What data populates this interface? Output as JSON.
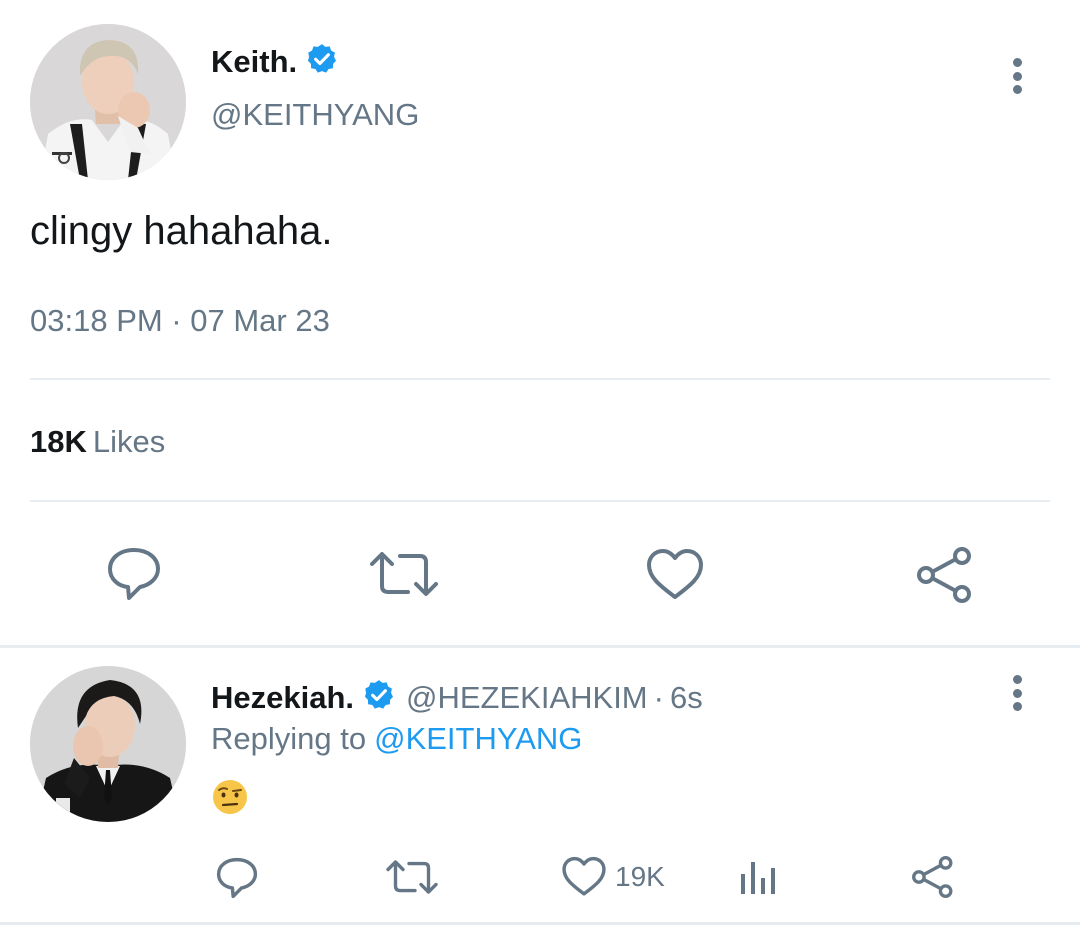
{
  "main_tweet": {
    "author_name": "Keith.",
    "author_handle": "@KEITHYANG",
    "text": "clingy hahahaha.",
    "timestamp": "03:18 PM · 07 Mar 23",
    "likes_count": "18K",
    "likes_label": "Likes",
    "icons": {
      "avatar": "avatar-photo",
      "verified": "verified-badge-icon",
      "more": "more-options-icon",
      "reply": "reply-icon",
      "retweet": "retweet-icon",
      "like": "heart-icon",
      "share": "share-icon"
    }
  },
  "reply_tweet": {
    "author_name": "Hezekiah.",
    "author_handle": "@HEZEKIAHKIM",
    "separator": "·",
    "time_ago": "6s",
    "replying_label": "Replying to",
    "replying_handle": "@KEITHYANG",
    "emoji": "🤨",
    "like_count": "19K",
    "icons": {
      "avatar": "avatar-photo",
      "verified": "verified-badge-icon",
      "more": "more-options-icon",
      "reply": "reply-icon",
      "retweet": "retweet-icon",
      "like": "heart-icon",
      "analytics": "analytics-icon",
      "share": "share-icon"
    }
  },
  "colors": {
    "text_primary": "#14171a",
    "text_secondary": "#657786",
    "accent_blue": "#1d9bf0",
    "divider": "#e6ecf0"
  }
}
